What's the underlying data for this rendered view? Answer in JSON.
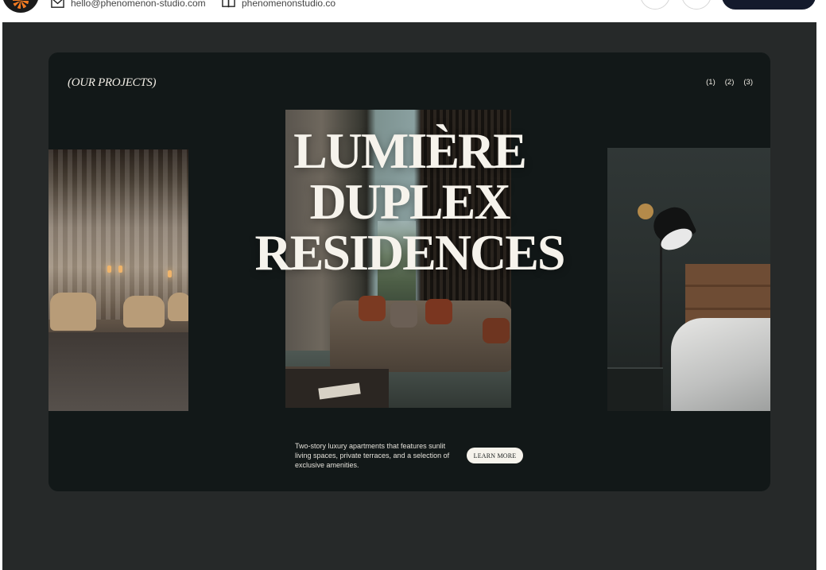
{
  "header": {
    "email": "hello@phenomenon-studio.com",
    "website": "phenomenonstudio.co",
    "icons": {
      "logo": "phenomenon-logo",
      "email": "envelope-icon",
      "website": "book-icon"
    }
  },
  "projects": {
    "section_label": "(OUR PROJECTS)",
    "pager": [
      "(1)",
      "(2)",
      "(3)"
    ],
    "title_line1": "LUMIÈRE DUPLEX",
    "title_line2": "RESIDENCES",
    "description": "Two-story luxury apartments that features sunlit living spaces, private terraces, and a selection of exclusive amenities.",
    "cta_label": "LEARN MORE",
    "photos": [
      "lounge-interior-photo",
      "living-room-photo",
      "bedroom-photo"
    ]
  },
  "colors": {
    "stage_bg": "#262929",
    "card_bg": "#121818",
    "text_light": "#f6f3ec",
    "cta_dark": "#141a2c",
    "brand_orange": "#f07a22"
  }
}
